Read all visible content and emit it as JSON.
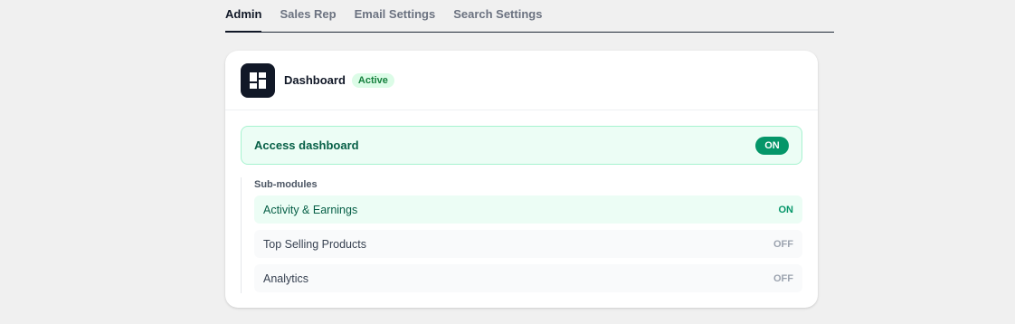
{
  "tabs": [
    {
      "label": "Admin",
      "active": true
    },
    {
      "label": "Sales Rep",
      "active": false
    },
    {
      "label": "Email Settings",
      "active": false
    },
    {
      "label": "Search Settings",
      "active": false
    }
  ],
  "module": {
    "icon": "dashboard-icon",
    "title": "Dashboard",
    "badge": "Active"
  },
  "access": {
    "label": "Access dashboard",
    "state": "ON"
  },
  "submodules": {
    "heading": "Sub-modules",
    "items": [
      {
        "label": "Activity & Earnings",
        "state": "ON"
      },
      {
        "label": "Top Selling Products",
        "state": "OFF"
      },
      {
        "label": "Analytics",
        "state": "OFF"
      }
    ]
  },
  "colors": {
    "accent": "#059669",
    "on_bg": "#ecfdf5",
    "badge_bg": "#dcfce7",
    "icon_bg": "#111827"
  }
}
